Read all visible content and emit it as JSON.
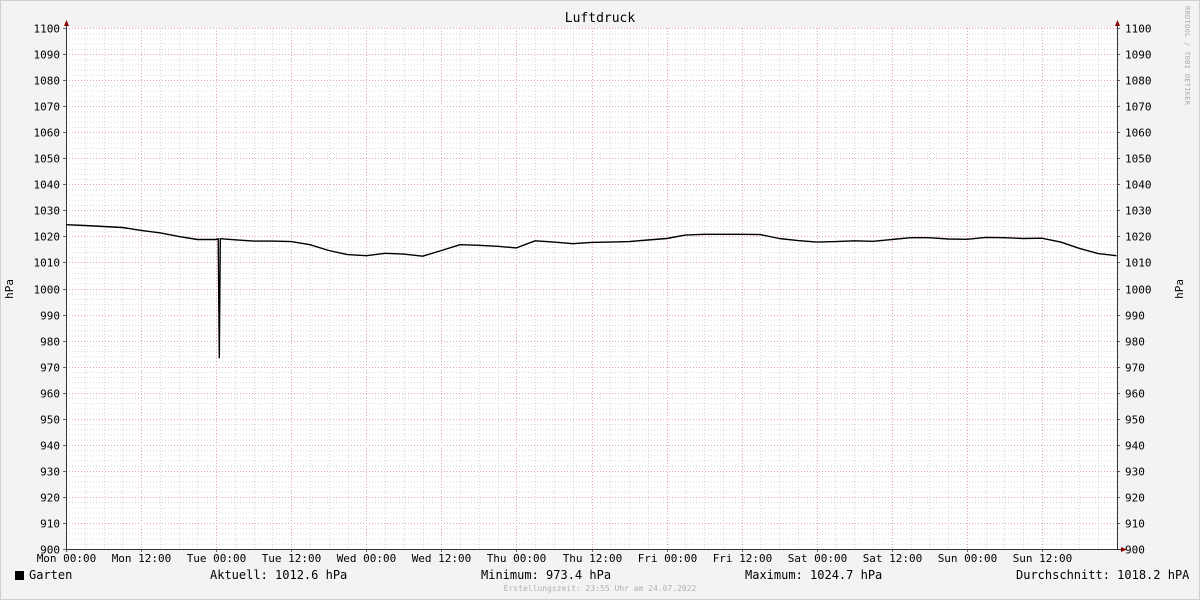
{
  "chart_data": {
    "type": "line",
    "title": "Luftdruck",
    "ylabel": "hPa",
    "ylabel_right": "hPa",
    "xlabel": "",
    "ylim": [
      900,
      1100
    ],
    "ytick_step": 10,
    "xlim": [
      "2022-07-18 00:00",
      "2022-07-25 00:00"
    ],
    "x_ticks": [
      "Mon 00:00",
      "Mon 12:00",
      "Tue 00:00",
      "Tue 12:00",
      "Wed 00:00",
      "Wed 12:00",
      "Thu 00:00",
      "Thu 12:00",
      "Fri 00:00",
      "Fri 12:00",
      "Sat 00:00",
      "Sat 12:00",
      "Sun 00:00",
      "Sun 12:00"
    ],
    "grid": true,
    "series": [
      {
        "name": "Garten",
        "color": "#000000",
        "x": [
          "2022-07-18 00:00",
          "2022-07-18 03:00",
          "2022-07-18 06:00",
          "2022-07-18 09:00",
          "2022-07-18 12:00",
          "2022-07-18 15:00",
          "2022-07-18 18:00",
          "2022-07-18 21:00",
          "2022-07-19 00:00",
          "2022-07-19 00:20",
          "2022-07-19 00:30",
          "2022-07-19 00:40",
          "2022-07-19 03:00",
          "2022-07-19 06:00",
          "2022-07-19 09:00",
          "2022-07-19 12:00",
          "2022-07-19 15:00",
          "2022-07-19 18:00",
          "2022-07-19 21:00",
          "2022-07-20 00:00",
          "2022-07-20 03:00",
          "2022-07-20 06:00",
          "2022-07-20 09:00",
          "2022-07-20 12:00",
          "2022-07-20 15:00",
          "2022-07-20 18:00",
          "2022-07-20 21:00",
          "2022-07-21 00:00",
          "2022-07-21 03:00",
          "2022-07-21 06:00",
          "2022-07-21 09:00",
          "2022-07-21 12:00",
          "2022-07-21 15:00",
          "2022-07-21 18:00",
          "2022-07-21 21:00",
          "2022-07-22 00:00",
          "2022-07-22 03:00",
          "2022-07-22 06:00",
          "2022-07-22 09:00",
          "2022-07-22 12:00",
          "2022-07-22 15:00",
          "2022-07-22 18:00",
          "2022-07-22 21:00",
          "2022-07-23 00:00",
          "2022-07-23 03:00",
          "2022-07-23 06:00",
          "2022-07-23 09:00",
          "2022-07-23 12:00",
          "2022-07-23 15:00",
          "2022-07-23 18:00",
          "2022-07-23 21:00",
          "2022-07-24 00:00",
          "2022-07-24 03:00",
          "2022-07-24 06:00",
          "2022-07-24 09:00",
          "2022-07-24 12:00",
          "2022-07-24 15:00",
          "2022-07-24 18:00",
          "2022-07-24 21:00",
          "2022-07-24 23:55"
        ],
        "values": [
          1024.5,
          1024.2,
          1023.8,
          1023.4,
          1022.3,
          1021.4,
          1020.0,
          1018.8,
          1018.8,
          1019.1,
          973.4,
          1019.1,
          1018.7,
          1018.2,
          1018.2,
          1018.0,
          1016.8,
          1014.6,
          1013.0,
          1012.6,
          1013.5,
          1013.2,
          1012.4,
          1014.6,
          1016.8,
          1016.6,
          1016.2,
          1015.6,
          1018.3,
          1017.8,
          1017.2,
          1017.7,
          1017.8,
          1018.0,
          1018.6,
          1019.2,
          1020.5,
          1020.8,
          1020.8,
          1020.8,
          1020.7,
          1019.2,
          1018.4,
          1017.8,
          1018.0,
          1018.3,
          1018.1,
          1018.8,
          1019.5,
          1019.5,
          1019.0,
          1018.9,
          1019.6,
          1019.5,
          1019.2,
          1019.3,
          1017.8,
          1015.4,
          1013.4,
          1012.6
        ]
      }
    ]
  },
  "legend": {
    "series_label": "Garten",
    "current": "Aktuell: 1012.6 hPa",
    "minimum": "Minimum: 973.4 hPa",
    "maximum": "Maximum: 1024.7 hPa",
    "average": "Durchschnitt: 1018.2 hPA"
  },
  "footer": "Erstellungszeit: 23:55 Uhr am 24.07.2022",
  "watermark": "RRDTOOL / TOBI OETIKER"
}
